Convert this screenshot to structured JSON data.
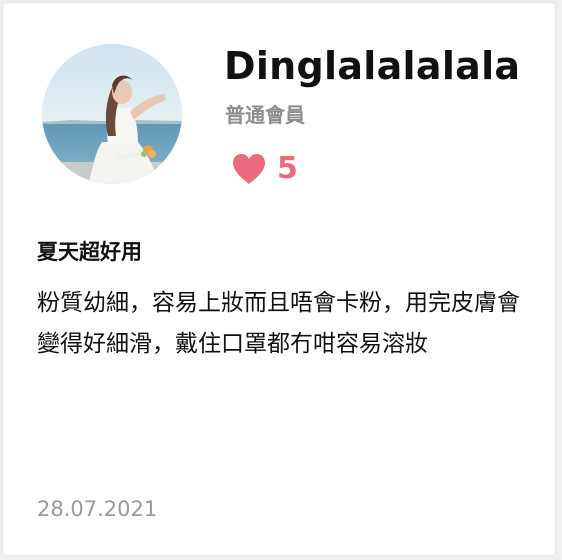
{
  "review": {
    "user": {
      "name": "Dinglalalalala",
      "member_level": "普通會員",
      "avatar": "avatar-photo"
    },
    "likes": {
      "icon": "heart-icon",
      "count": "5",
      "color": "#ec6a7d"
    },
    "title": "夏天超好用",
    "body": "粉質幼細，容易上妝而且唔會卡粉，用完皮膚會變得好細滑，戴住口罩都冇咁容易溶妝",
    "date": "28.07.2021"
  }
}
